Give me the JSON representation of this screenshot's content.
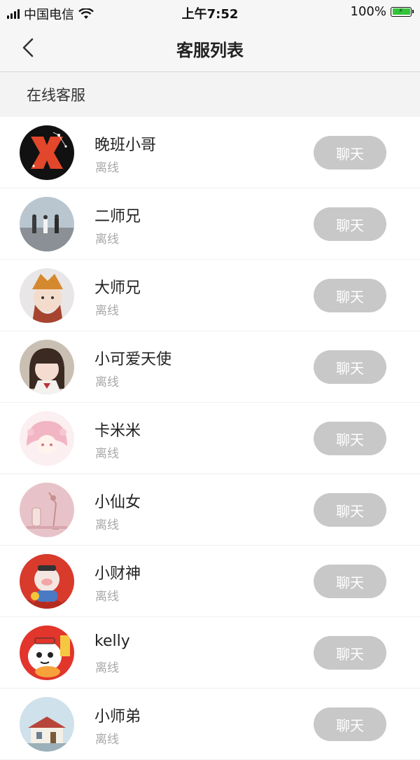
{
  "status_bar": {
    "carrier": "中国电信",
    "time": "上午7:52",
    "battery_percent": "100%"
  },
  "nav": {
    "title": "客服列表",
    "back_icon": "chevron-left-icon"
  },
  "section": {
    "title": "在线客服"
  },
  "agents": [
    {
      "name": "晚班小哥",
      "status": "离线",
      "action": "聊天"
    },
    {
      "name": "二师兄",
      "status": "离线",
      "action": "聊天"
    },
    {
      "name": "大师兄",
      "status": "离线",
      "action": "聊天"
    },
    {
      "name": "小可爱天使",
      "status": "离线",
      "action": "聊天"
    },
    {
      "name": "卡米米",
      "status": "离线",
      "action": "聊天"
    },
    {
      "name": "小仙女",
      "status": "离线",
      "action": "聊天"
    },
    {
      "name": "小财神",
      "status": "离线",
      "action": "聊天"
    },
    {
      "name": "kelly",
      "status": "离线",
      "action": "聊天"
    },
    {
      "name": "小师弟",
      "status": "离线",
      "action": "聊天"
    }
  ],
  "colors": {
    "button_bg": "#c8c8c8",
    "status_text": "#a8a8a8",
    "battery": "#33c43a"
  }
}
